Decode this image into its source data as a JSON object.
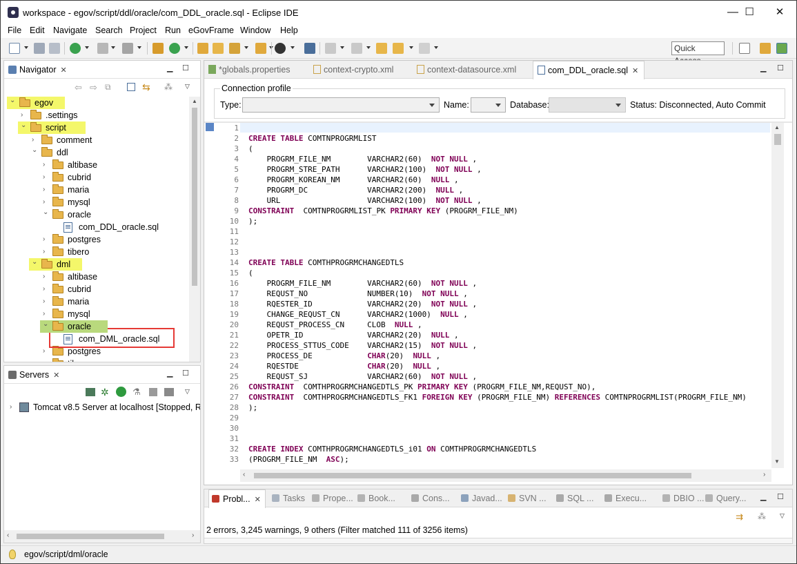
{
  "window": {
    "title": "workspace - egov/script/ddl/oracle/com_DDL_oracle.sql - Eclipse IDE",
    "minimize": "—",
    "maximize": "☐",
    "close": "✕"
  },
  "menu": [
    "File",
    "Edit",
    "Navigate",
    "Search",
    "Project",
    "Run",
    "eGovFrame",
    "Window",
    "Help"
  ],
  "toolbar": {
    "quick_access": "Quick Access"
  },
  "navigator": {
    "tab_label": "Navigator",
    "tree": [
      {
        "label": "egov",
        "level": 0,
        "type": "project",
        "expanded": true,
        "highlight": "yellow"
      },
      {
        "label": ".settings",
        "level": 1,
        "type": "folder",
        "expanded": false
      },
      {
        "label": "script",
        "level": 1,
        "type": "folder",
        "expanded": true,
        "highlight": "yellow"
      },
      {
        "label": "comment",
        "level": 2,
        "type": "folder",
        "expanded": false
      },
      {
        "label": "ddl",
        "level": 2,
        "type": "folder",
        "expanded": true
      },
      {
        "label": "altibase",
        "level": 3,
        "type": "folder",
        "expanded": false
      },
      {
        "label": "cubrid",
        "level": 3,
        "type": "folder",
        "expanded": false
      },
      {
        "label": "maria",
        "level": 3,
        "type": "folder",
        "expanded": false
      },
      {
        "label": "mysql",
        "level": 3,
        "type": "folder",
        "expanded": false
      },
      {
        "label": "oracle",
        "level": 3,
        "type": "folder",
        "expanded": true
      },
      {
        "label": "com_DDL_oracle.sql",
        "level": 4,
        "type": "file"
      },
      {
        "label": "postgres",
        "level": 3,
        "type": "folder",
        "expanded": false
      },
      {
        "label": "tibero",
        "level": 3,
        "type": "folder",
        "expanded": false
      },
      {
        "label": "dml",
        "level": 2,
        "type": "folder",
        "expanded": true,
        "highlight": "yellow"
      },
      {
        "label": "altibase",
        "level": 3,
        "type": "folder",
        "expanded": false
      },
      {
        "label": "cubrid",
        "level": 3,
        "type": "folder",
        "expanded": false
      },
      {
        "label": "maria",
        "level": 3,
        "type": "folder",
        "expanded": false
      },
      {
        "label": "mysql",
        "level": 3,
        "type": "folder",
        "expanded": false
      },
      {
        "label": "oracle",
        "level": 3,
        "type": "folder",
        "expanded": true,
        "highlight": "green"
      },
      {
        "label": "com_DML_oracle.sql",
        "level": 4,
        "type": "file",
        "boxed": true
      },
      {
        "label": "postgres",
        "level": 3,
        "type": "folder",
        "expanded": false
      },
      {
        "label": "tibero",
        "level": 3,
        "type": "folder",
        "expanded": false
      }
    ]
  },
  "servers": {
    "tab_label": "Servers",
    "items": [
      "Tomcat v8.5 Server at localhost  [Stopped, R"
    ]
  },
  "editor": {
    "tabs": [
      {
        "label": "*globals.properties",
        "active": false
      },
      {
        "label": "context-crypto.xml",
        "active": false
      },
      {
        "label": "context-datasource.xml",
        "active": false
      },
      {
        "label": "com_DDL_oracle.sql",
        "active": true
      }
    ],
    "connection_profile": {
      "legend": "Connection profile",
      "type_label": "Type:",
      "name_label": "Name:",
      "database_label": "Database:",
      "status": "Status: Disconnected, Auto Commit"
    },
    "lines": [
      {
        "n": "1",
        "t": ""
      },
      {
        "n": "2",
        "t": "<k>CREATE TABLE</k> COMTNPROGRMLIST"
      },
      {
        "n": "3",
        "t": "("
      },
      {
        "n": "4",
        "t": "    PROGRM_FILE_NM        VARCHAR2(60)  <k>NOT NULL</k> ,"
      },
      {
        "n": "5",
        "t": "    PROGRM_STRE_PATH      VARCHAR2(100)  <k>NOT NULL</k> ,"
      },
      {
        "n": "6",
        "t": "    PROGRM_KOREAN_NM      VARCHAR2(60)  <k>NULL</k> ,"
      },
      {
        "n": "7",
        "t": "    PROGRM_DC             VARCHAR2(200)  <k>NULL</k> ,"
      },
      {
        "n": "8",
        "t": "    URL                   VARCHAR2(100)  <k>NOT NULL</k> ,"
      },
      {
        "n": "9",
        "t": "<k>CONSTRAINT</k>  COMTNPROGRMLIST_PK <k>PRIMARY KEY</k> (PROGRM_FILE_NM)"
      },
      {
        "n": "10",
        "t": ");"
      },
      {
        "n": "11",
        "t": ""
      },
      {
        "n": "12",
        "t": ""
      },
      {
        "n": "13",
        "t": ""
      },
      {
        "n": "14",
        "t": "<k>CREATE TABLE</k> COMTHPROGRMCHANGEDTLS"
      },
      {
        "n": "15",
        "t": "("
      },
      {
        "n": "16",
        "t": "    PROGRM_FILE_NM        VARCHAR2(60)  <k>NOT NULL</k> ,"
      },
      {
        "n": "17",
        "t": "    REQUST_NO             NUMBER(10)  <k>NOT NULL</k> ,"
      },
      {
        "n": "18",
        "t": "    RQESTER_ID            VARCHAR2(20)  <k>NOT NULL</k> ,"
      },
      {
        "n": "19",
        "t": "    CHANGE_REQUST_CN      VARCHAR2(1000)  <k>NULL</k> ,"
      },
      {
        "n": "20",
        "t": "    REQUST_PROCESS_CN     CLOB  <k>NULL</k> ,"
      },
      {
        "n": "21",
        "t": "    OPETR_ID              VARCHAR2(20)  <k>NULL</k> ,"
      },
      {
        "n": "22",
        "t": "    PROCESS_STTUS_CODE    VARCHAR2(15)  <k>NOT NULL</k> ,"
      },
      {
        "n": "23",
        "t": "    PROCESS_DE            <k>CHAR</k>(20)  <k>NULL</k> ,"
      },
      {
        "n": "24",
        "t": "    RQESTDE               <k>CHAR</k>(20)  <k>NULL</k> ,"
      },
      {
        "n": "25",
        "t": "    REQUST_SJ             VARCHAR2(60)  <k>NOT NULL</k> ,"
      },
      {
        "n": "26",
        "t": "<k>CONSTRAINT</k>  COMTHPROGRMCHANGEDTLS_PK <k>PRIMARY KEY</k> (PROGRM_FILE_NM,REQUST_NO),"
      },
      {
        "n": "27",
        "t": "<k>CONSTRAINT</k>  COMTHPROGRMCHANGEDTLS_FK1 <k>FOREIGN KEY</k> (PROGRM_FILE_NM) <k>REFERENCES</k> COMTNPROGRMLIST(PROGRM_FILE_NM)"
      },
      {
        "n": "28",
        "t": ");"
      },
      {
        "n": "29",
        "t": ""
      },
      {
        "n": "30",
        "t": ""
      },
      {
        "n": "31",
        "t": ""
      },
      {
        "n": "32",
        "t": "<k>CREATE INDEX</k> COMTHPROGRMCHANGEDTLS_i01 <k>ON</k> COMTHPROGRMCHANGEDTLS"
      },
      {
        "n": "33",
        "t": "(PROGRM_FILE_NM  <k>ASC</k>);"
      }
    ]
  },
  "bottom": {
    "tabs": [
      "Probl...",
      "Tasks",
      "Prope...",
      "Book...",
      "Cons...",
      "Javad...",
      "SVN ...",
      "SQL ...",
      "Execu...",
      "DBIO ...",
      "Query..."
    ],
    "summary": "2 errors, 3,245 warnings, 9 others (Filter matched 111 of 3256 items)"
  },
  "statusbar": {
    "path": "egov/script/dml/oracle"
  },
  "colors": {
    "keyword": "#7f0055",
    "highlight_yellow": "#f4f76a",
    "highlight_green": "#b9d97d",
    "annotation_box": "#e53935"
  }
}
